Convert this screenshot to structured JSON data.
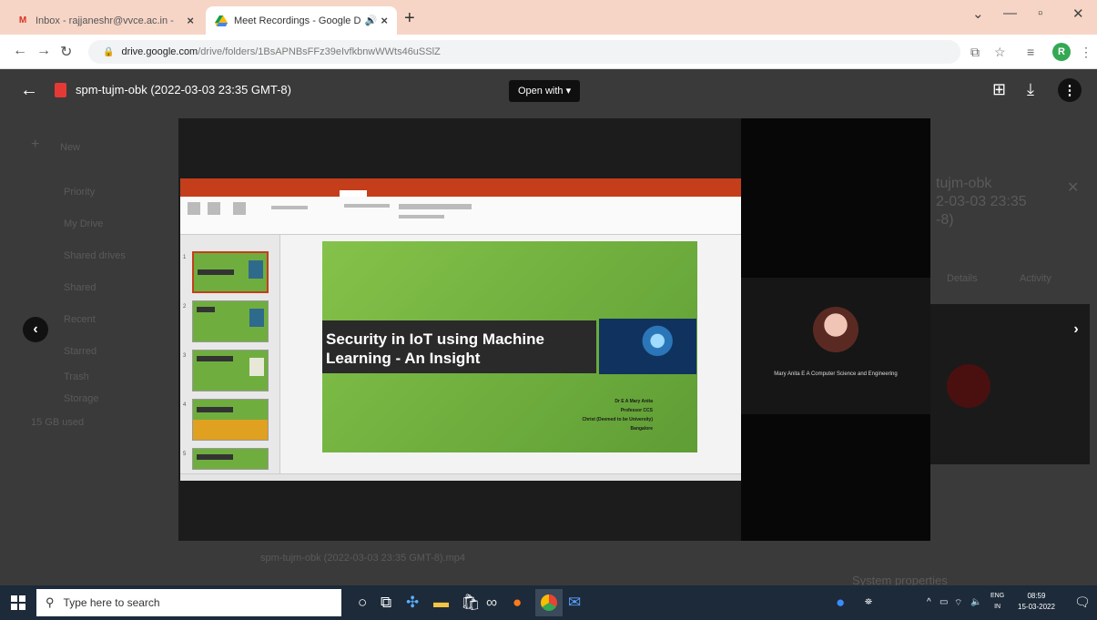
{
  "browser": {
    "tabs": [
      {
        "label": "Inbox - rajjaneshr@vvce.ac.in - ",
        "favicon": "gmail-icon",
        "active": false
      },
      {
        "label": "Meet Recordings - Google D",
        "favicon": "drive-icon",
        "active": true
      }
    ],
    "url_host": "drive.google.com",
    "url_path": "/drive/folders/1BsAPNBsFFz39eIvfkbnwWWts46uSSlZ",
    "profile_initial": "R"
  },
  "viewer": {
    "file_title": "spm-tujm-obk (2022-03-03 23:35 GMT-8)",
    "open_with_label": "Open with ▾",
    "participant_name": "Mary Anita E A Computer Science and Engineering"
  },
  "slide": {
    "title_line1": "Security in IoT using Machine",
    "title_line2": "Learning - An Insight",
    "author_lines": [
      "Dr E A Mary Anita",
      "Professor CCS",
      "Christ (Deemed to be University)",
      "Bangalore"
    ]
  },
  "background": {
    "sidebar": [
      "New",
      "Priority",
      "My Drive",
      "Shared drives",
      "Shared",
      "Recent",
      "Starred",
      "Trash",
      "Storage",
      "15 GB used"
    ],
    "panel_title": [
      "tujm-obk",
      "2-03-03 23:35",
      "-8)"
    ],
    "panel_tabs": [
      "Details",
      "Activity"
    ],
    "file_row": "spm-tujm-obk (2022-03-03 23:35 GMT-8).mp4",
    "system_properties": "System properties"
  },
  "taskbar": {
    "search_placeholder": "Type here to search",
    "lang": "ENG",
    "region": "IN",
    "time": "08:59",
    "date": "15-03-2022"
  }
}
